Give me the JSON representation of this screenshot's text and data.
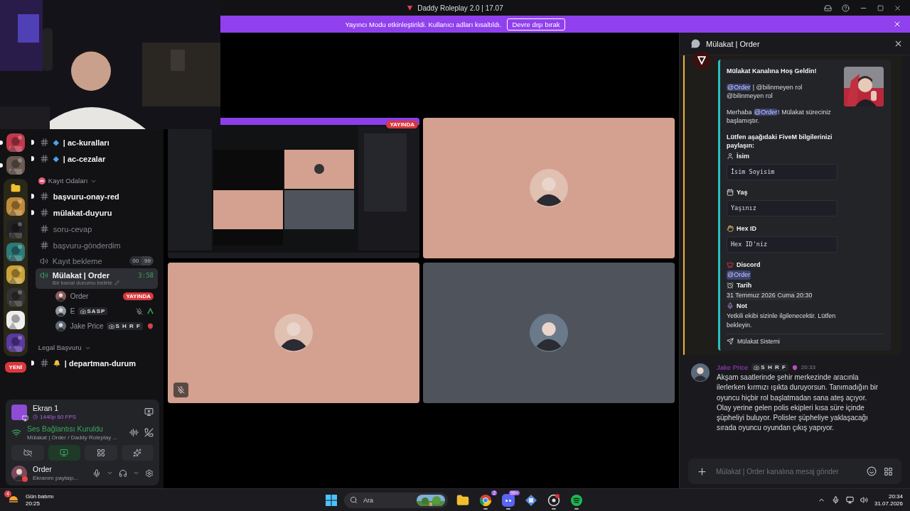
{
  "titlebar": {
    "title": "Daddy Roleplay 2.0 | 17.07"
  },
  "banner": {
    "message": "Yayıncı Modu etkinleştirildi. Kullanıcı adları kısaltıldı.",
    "action": "Devre dışı bırak"
  },
  "servers": [
    {
      "unread": true
    },
    {
      "unread": true
    }
  ],
  "folder": {
    "expanded": true,
    "servers": [
      {
        "unread": true
      },
      {
        "unread": true
      },
      {
        "unread": true
      },
      {
        "unread": true
      },
      {
        "unread": true
      },
      {
        "unread": true
      },
      {
        "unread": true
      }
    ]
  },
  "new_badge": "YENİ",
  "channels": [
    {
      "kind": "text",
      "prefix": "◆",
      "name": "| ac-kuralları",
      "unread": true,
      "selected": false
    },
    {
      "kind": "text",
      "prefix": "◆",
      "name": "| ac-cezalar",
      "unread": true,
      "selected": false
    },
    {
      "kind": "category-emoji",
      "name": "Kayıt Odaları"
    },
    {
      "kind": "text",
      "name": "başvuru-onay-red",
      "unread": true,
      "selected": false
    },
    {
      "kind": "text",
      "name": "mülakat-duyuru",
      "unread": true,
      "selected": false
    },
    {
      "kind": "text",
      "name": "soru-cevap",
      "unread": false,
      "selected": false
    },
    {
      "kind": "text",
      "name": "başvuru-gönderdim",
      "unread": false,
      "selected": false
    },
    {
      "kind": "voice",
      "name": "Kayıt bekleme",
      "count": "00",
      "limit": "99",
      "selected": false
    },
    {
      "kind": "voice",
      "name": "Mülakat | Order",
      "timer": "3:58",
      "status": "Bir kanal durumu belirle",
      "selected": true,
      "members": [
        {
          "name": "Order",
          "live": "YAYINDA",
          "muted": false,
          "boost": false
        },
        {
          "name": "E",
          "tag": "SASP",
          "muted": true,
          "boost": false
        },
        {
          "name": "Jake Price",
          "tag": "S H R F",
          "muted": false,
          "boost": true
        }
      ]
    },
    {
      "kind": "category",
      "name": "Legal Başvuru"
    },
    {
      "kind": "text-emoji",
      "name": "| departman-durum",
      "unread": true,
      "selected": false
    }
  ],
  "stream": {
    "title": "Ekran 1",
    "quality": "1440p 60 FPS"
  },
  "voice": {
    "status": "Ses Bağlantısı Kuruldu",
    "location": "Mülakat | Order / Daddy Roleplay ..."
  },
  "controls": [
    {
      "kind": "camera",
      "active": false
    },
    {
      "kind": "screen",
      "active": true
    },
    {
      "kind": "activities",
      "active": false
    },
    {
      "kind": "soundboard",
      "active": false
    }
  ],
  "user": {
    "name": "Order",
    "status": "Ekranını paylaşı...",
    "color": "#f23f43"
  },
  "tiles": [
    {
      "kind": "screen",
      "badge": "YAYINDA",
      "muted": false
    },
    {
      "kind": "avatar",
      "color": "#d4a08f",
      "muted": false
    },
    {
      "kind": "avatar",
      "color": "#d4a08f",
      "muted": true
    },
    {
      "kind": "avatar",
      "color": "#4f545c",
      "muted": false
    }
  ],
  "thread": {
    "title": "Mülakat | Order"
  },
  "embed": {
    "title": "Mülakat Kanalına Hoş Geldin!",
    "mentions": [
      {
        "kind": "mention",
        "text": "@Order"
      },
      {
        "kind": "plain",
        "text": " | @bilinmeyen rol @bilinmeyen rol"
      }
    ],
    "greeting": [
      {
        "kind": "plain",
        "text": "Merhaba "
      },
      {
        "kind": "mention",
        "text": "@Order"
      },
      {
        "kind": "plain",
        "text": "! Mülakat süreciniz başlamıştır."
      }
    ],
    "prompt": "Lütfen aşağıdaki FiveM bilgilerinizi paylaşın:",
    "fields": [
      {
        "kind": "code",
        "label": "İsim",
        "value": "İsim Soyisim"
      },
      {
        "kind": "code",
        "label": "Yaş",
        "value": "Yaşınız"
      },
      {
        "kind": "code",
        "label": "Hex ID",
        "value": "Hex ID'niz"
      },
      {
        "kind": "mention",
        "label": "Discord",
        "value": "@Order"
      },
      {
        "kind": "inline",
        "label": "Tarih",
        "value": "31 Temmuz 2026 Cuma 20:30"
      },
      {
        "kind": "text",
        "label": "Not",
        "value": "Yetkili ekibi sizinle ilgilenecektir. Lütfen bekleyin."
      }
    ],
    "footer": "Mülakat Sistemi"
  },
  "message": {
    "author": "Jake Price",
    "tag": "S H R F",
    "time": "20:33",
    "text": "Akşam saatlerinde şehir merkezinde aracınla ilerlerken kırmızı ışıkta duruyorsun. Tanımadığın bir oyuncu hiçbir rol başlatmadan sana ateş açıyor. Olay yerine gelen polis ekipleri kısa süre içinde şüpheliyi buluyor. Polisler şüpheliye yaklaşacağı sırada oyuncu oyundan çıkış yapıyor."
  },
  "composer": {
    "placeholder": "Mülakat | Order kanalına mesaj gönder"
  },
  "taskbar": {
    "weather": {
      "label": "Gün batımı",
      "time": "20:25",
      "badge": "4"
    },
    "search": {
      "placeholder": "Ara"
    },
    "apps": [
      {
        "kind": "files",
        "running": false
      },
      {
        "kind": "browser",
        "badge": "2",
        "running": true
      },
      {
        "kind": "chat",
        "badge": "99+",
        "running": true
      },
      {
        "kind": "game",
        "running": false
      },
      {
        "kind": "tool",
        "running": true
      },
      {
        "kind": "music",
        "running": true
      }
    ],
    "clock": {
      "time": "20:34",
      "date": "31.07.2026"
    }
  }
}
